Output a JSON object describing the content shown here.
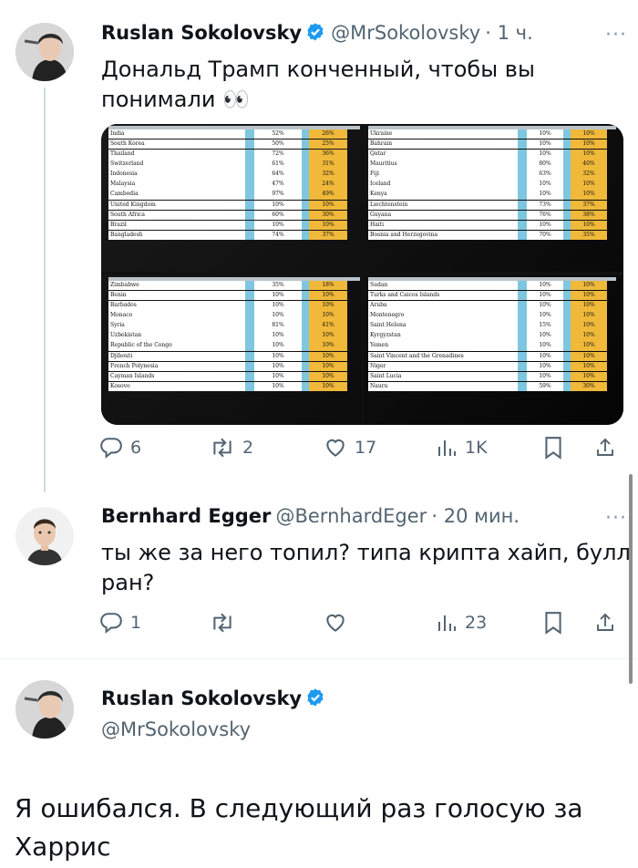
{
  "tweet1": {
    "author": "Ruslan Sokolovsky",
    "handle": "@MrSokolovsky",
    "time": "· 1 ч.",
    "text_line1": "Дональд Трамп конченный, чтобы вы",
    "text_line2": "понимали 👀",
    "replies": "6",
    "retweets": "2",
    "likes": "17",
    "views": "1K",
    "more": "···"
  },
  "table_tl": [
    [
      "India",
      "52%",
      "26%"
    ],
    [
      "South Korea",
      "50%",
      "25%"
    ],
    [
      "Thailand",
      "72%",
      "36%"
    ],
    [
      "Switzerland",
      "61%",
      "31%"
    ],
    [
      "Indonesia",
      "64%",
      "32%"
    ],
    [
      "Malaysia",
      "47%",
      "24%"
    ],
    [
      "Cambodia",
      "97%",
      "49%"
    ],
    [
      "United Kingdom",
      "10%",
      "10%"
    ],
    [
      "South Africa",
      "60%",
      "30%"
    ],
    [
      "Brazil",
      "10%",
      "10%"
    ],
    [
      "Bangladesh",
      "74%",
      "37%"
    ]
  ],
  "table_tr": [
    [
      "Ukraine",
      "10%",
      "10%"
    ],
    [
      "Bahrain",
      "10%",
      "10%"
    ],
    [
      "Qatar",
      "10%",
      "10%"
    ],
    [
      "Mauritius",
      "80%",
      "40%"
    ],
    [
      "Fiji",
      "63%",
      "32%"
    ],
    [
      "Iceland",
      "10%",
      "10%"
    ],
    [
      "Kenya",
      "10%",
      "10%"
    ],
    [
      "Liechtenstein",
      "73%",
      "37%"
    ],
    [
      "Guyana",
      "76%",
      "38%"
    ],
    [
      "Haiti",
      "10%",
      "10%"
    ],
    [
      "Bosnia and Herzegovina",
      "70%",
      "35%"
    ]
  ],
  "table_bl": [
    [
      "Zimbabwe",
      "35%",
      "18%"
    ],
    [
      "Benin",
      "10%",
      "10%"
    ],
    [
      "Barbados",
      "10%",
      "10%"
    ],
    [
      "Monaco",
      "10%",
      "10%"
    ],
    [
      "Syria",
      "81%",
      "41%"
    ],
    [
      "Uzbekistan",
      "10%",
      "10%"
    ],
    [
      "Republic of the Congo",
      "10%",
      "10%"
    ],
    [
      "Djibouti",
      "10%",
      "10%"
    ],
    [
      "French Polynesia",
      "10%",
      "10%"
    ],
    [
      "Cayman Islands",
      "10%",
      "10%"
    ],
    [
      "Kosovo",
      "10%",
      "10%"
    ]
  ],
  "table_br": [
    [
      "Sudan",
      "10%",
      "10%"
    ],
    [
      "Turks and Caicos Islands",
      "10%",
      "10%"
    ],
    [
      "Aruba",
      "10%",
      "10%"
    ],
    [
      "Montenegro",
      "10%",
      "10%"
    ],
    [
      "Saint Helena",
      "15%",
      "10%"
    ],
    [
      "Kyrgyzstan",
      "10%",
      "10%"
    ],
    [
      "Yemen",
      "10%",
      "10%"
    ],
    [
      "Saint Vincent and the Grenadines",
      "10%",
      "10%"
    ],
    [
      "Niger",
      "10%",
      "10%"
    ],
    [
      "Saint Lucia",
      "10%",
      "10%"
    ],
    [
      "Nauru",
      "59%",
      "30%"
    ]
  ],
  "tweet2": {
    "author": "Bernhard Egger",
    "handle": "@BernhardEger",
    "time": "· 20 мин.",
    "text_line1": "ты же за него топил? типа крипта хайп, булл",
    "text_line2": "ран?",
    "replies": "1",
    "views": "23",
    "more": "···"
  },
  "tweet3": {
    "author": "Ruslan Sokolovsky",
    "handle": "@MrSokolovsky",
    "text_line1": "Я ошибался. В следующий раз голосую за",
    "text_line2": "Харрис"
  },
  "colors": {
    "verified": "#1d9bf0",
    "muted": "#536471",
    "stripe": "#7fc6e0",
    "accent": "#f0b93a"
  },
  "icons": [
    "reply-icon",
    "retweet-icon",
    "like-icon",
    "views-icon",
    "bookmark-icon",
    "share-icon",
    "verified-icon",
    "more-icon"
  ]
}
